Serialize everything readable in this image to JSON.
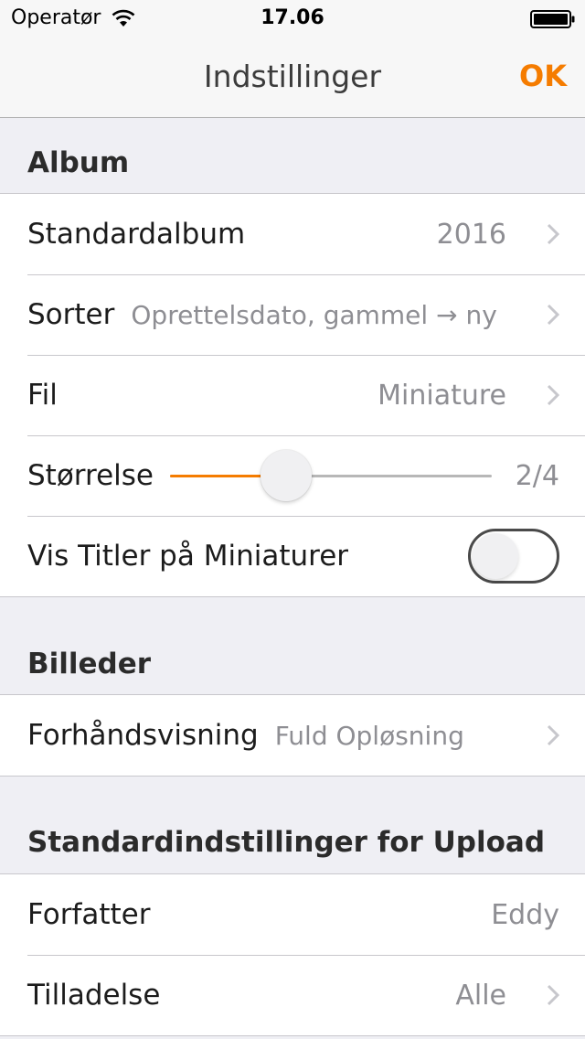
{
  "status_bar": {
    "carrier": "Operatør",
    "time": "17.06"
  },
  "nav": {
    "title": "Indstillinger",
    "ok_label": "OK"
  },
  "colors": {
    "accent": "#f57c00",
    "background": "#efeff4",
    "cell": "#ffffff",
    "secondary_text": "#8e8e93"
  },
  "album": {
    "header": "Album",
    "default_album": {
      "label": "Standardalbum",
      "value": "2016"
    },
    "sort": {
      "label": "Sorter",
      "value": "Oprettelsdato, gammel → ny"
    },
    "file": {
      "label": "Fil",
      "value": "Miniature"
    },
    "size": {
      "label": "Størrelse",
      "value": "2/4",
      "level": 2,
      "max": 4
    },
    "show_titles": {
      "label": "Vis Titler på Miniaturer",
      "enabled": false
    }
  },
  "images": {
    "header": "Billeder",
    "preview": {
      "label": "Forhåndsvisning",
      "value": "Fuld Opløsning"
    }
  },
  "upload_defaults": {
    "header": "Standardindstillinger for Upload",
    "author": {
      "label": "Forfatter",
      "value": "Eddy"
    },
    "permission": {
      "label": "Tilladelse",
      "value": "Alle"
    }
  }
}
